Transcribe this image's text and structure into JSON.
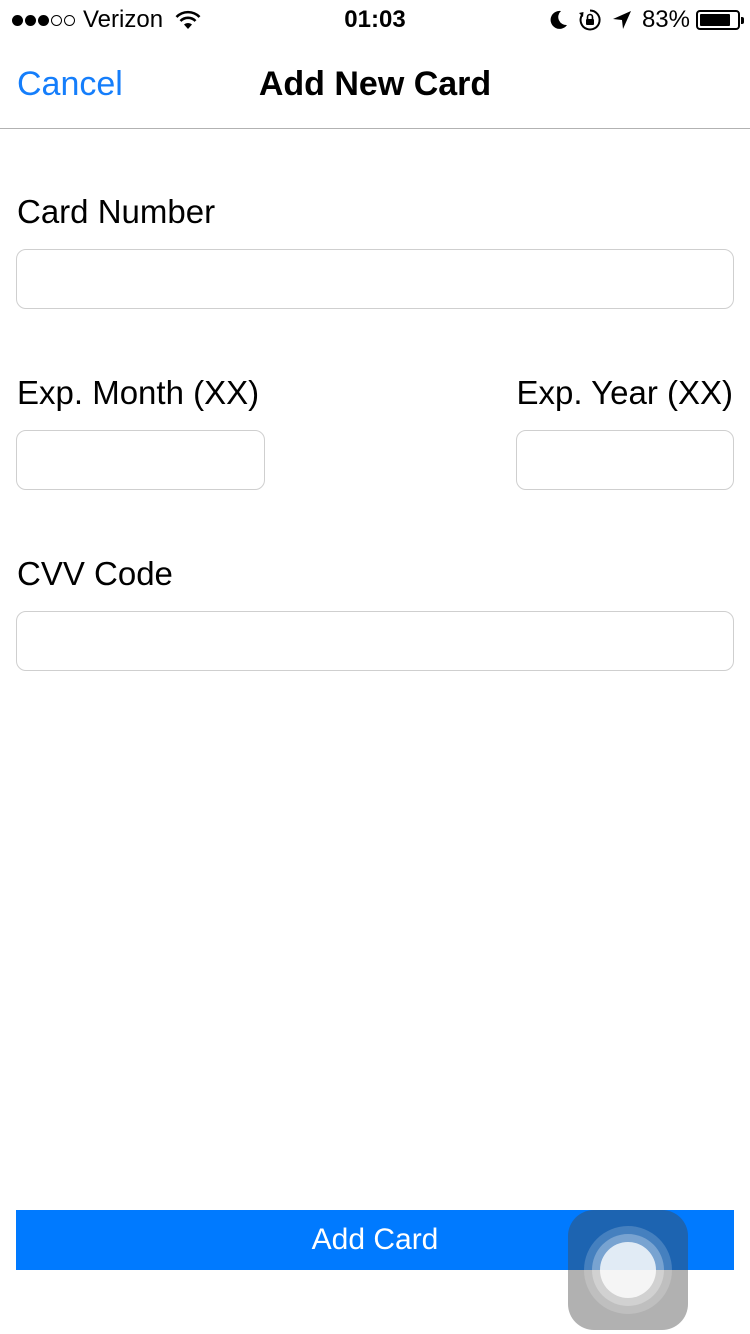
{
  "status_bar": {
    "carrier": "Verizon",
    "signal_bars_filled": 3,
    "signal_bars_total": 5,
    "time": "01:03",
    "battery_percent": "83%",
    "battery_level": 0.83,
    "icons": [
      "wifi-icon",
      "moon-icon",
      "rotation-lock-icon",
      "location-arrow-icon",
      "battery-icon"
    ]
  },
  "nav": {
    "cancel_label": "Cancel",
    "title": "Add New Card"
  },
  "form": {
    "card_number_label": "Card Number",
    "card_number_value": "",
    "exp_month_label": "Exp. Month (XX)",
    "exp_month_value": "",
    "exp_year_label": "Exp. Year (XX)",
    "exp_year_value": "",
    "cvv_label": "CVV Code",
    "cvv_value": ""
  },
  "actions": {
    "add_card_label": "Add Card"
  },
  "colors": {
    "accent": "#007aff",
    "link": "#157efb",
    "border": "#cfcfcf"
  }
}
